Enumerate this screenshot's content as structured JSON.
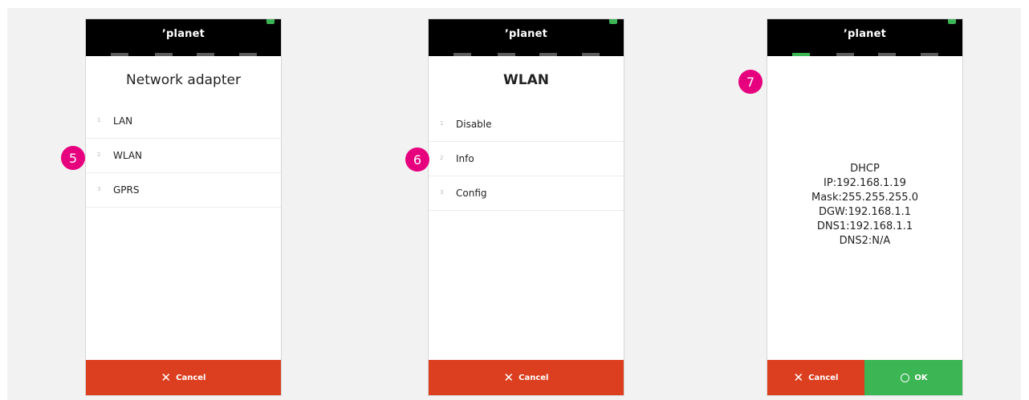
{
  "colors": {
    "accent_green": "#3cb554",
    "cancel_red": "#dc3f1f",
    "callout_pink": "#e6007e",
    "topbar_black": "#000000"
  },
  "callouts": [
    "5",
    "6",
    "7"
  ],
  "screens": [
    {
      "brand": "ʼplanet",
      "title": "Network adapter",
      "items": [
        {
          "num": "1",
          "label": "LAN"
        },
        {
          "num": "2",
          "label": "WLAN"
        },
        {
          "num": "3",
          "label": "GPRS"
        }
      ],
      "cancel_label": "Cancel"
    },
    {
      "brand": "ʼplanet",
      "title": "WLAN",
      "items": [
        {
          "num": "1",
          "label": "Disable"
        },
        {
          "num": "2",
          "label": "Info"
        },
        {
          "num": "3",
          "label": "Config"
        }
      ],
      "cancel_label": "Cancel"
    },
    {
      "brand": "ʼplanet",
      "info_lines": [
        "DHCP",
        "IP:192.168.1.19",
        "Mask:255.255.255.0",
        "DGW:192.168.1.1",
        "DNS1:192.168.1.1",
        "DNS2:N/A"
      ],
      "cancel_label": "Cancel",
      "ok_label": "OK"
    }
  ]
}
